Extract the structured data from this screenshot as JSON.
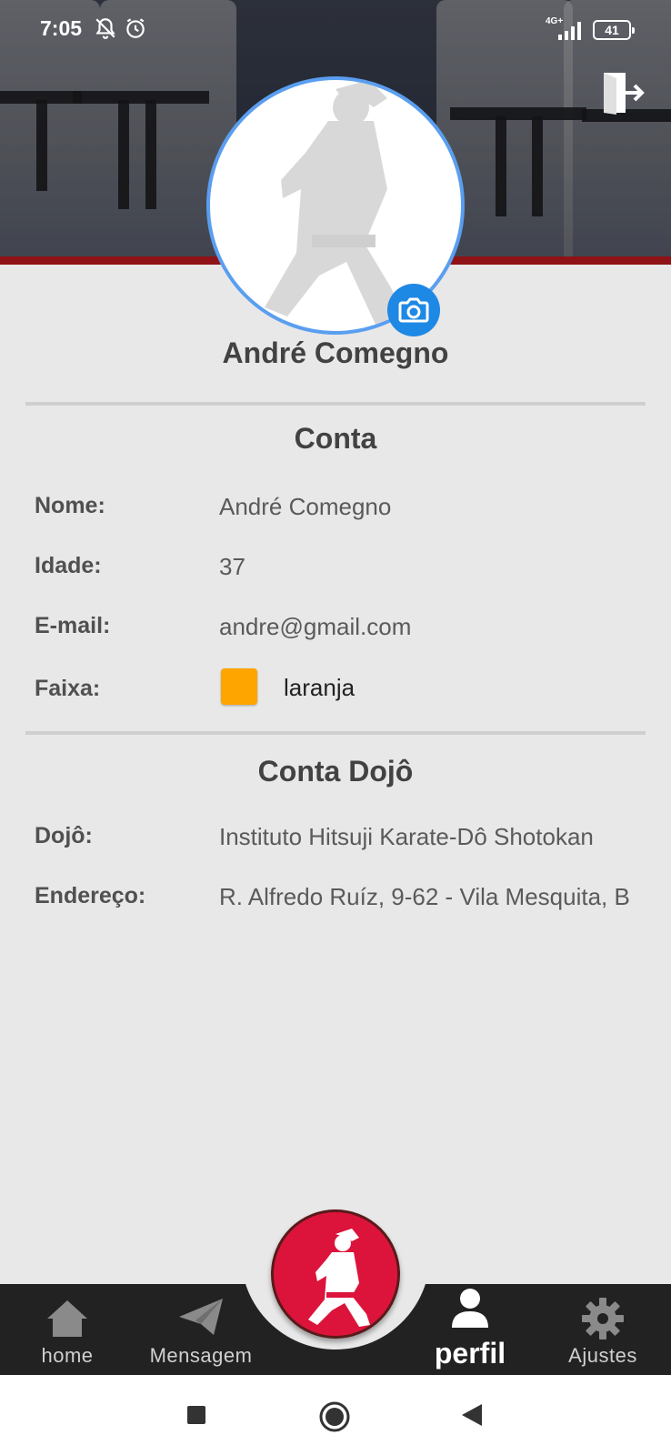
{
  "status_bar": {
    "time": "7:05",
    "network": "4G+",
    "battery": "41"
  },
  "profile": {
    "name": "André Comegno"
  },
  "account": {
    "title": "Conta",
    "fields": [
      {
        "label": "Nome:",
        "value": "André Comegno"
      },
      {
        "label": "Idade:",
        "value": "37"
      },
      {
        "label": "E-mail:",
        "value": "andre@gmail.com"
      },
      {
        "label": "Faixa:",
        "value": "laranja"
      }
    ],
    "belt_color": "#ffa500"
  },
  "dojo": {
    "title": "Conta Dojô",
    "fields": [
      {
        "label": "Dojô:",
        "value": "Instituto Hitsuji Karate-Dô Shotokan"
      },
      {
        "label": "Endereço:",
        "value": "R. Alfredo Ruíz, 9-62 - Vila Mesquita, B"
      }
    ]
  },
  "bottom_nav": {
    "items": [
      {
        "label": "home",
        "icon": "home-icon"
      },
      {
        "label": "Mensagem",
        "icon": "paper-plane-icon"
      },
      {
        "label": "perfil",
        "icon": "person-icon",
        "active": true
      },
      {
        "label": "Ajustes",
        "icon": "gear-icon"
      }
    ],
    "center_icon": "karate-fighter-icon"
  },
  "colors": {
    "accent_red": "#dc143c",
    "header_red": "#8e1216",
    "avatar_border": "#5a9ef0",
    "camera_blue": "#1e88e5",
    "nav_bg": "#222222"
  }
}
